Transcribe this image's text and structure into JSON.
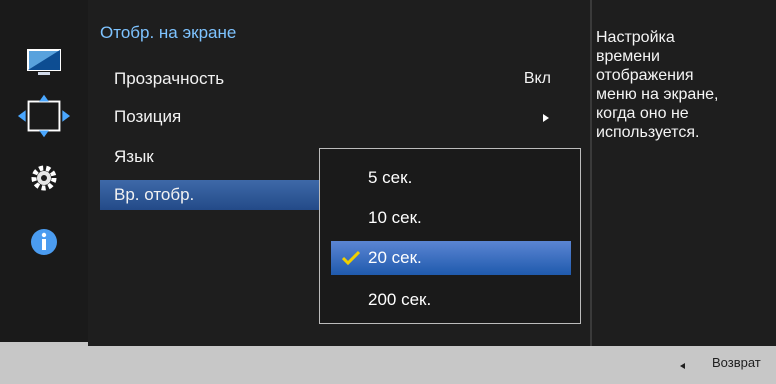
{
  "rail": {
    "icons": [
      "monitor-icon",
      "position-arrows-icon",
      "settings-gear-icon",
      "info-icon"
    ],
    "selected": "position-arrows-icon"
  },
  "menu": {
    "title": "Отобр. на экране",
    "items": [
      {
        "label": "Прозрачность",
        "value": "Вкл"
      },
      {
        "label": "Позиция",
        "value": ""
      },
      {
        "label": "Язык",
        "value": ""
      },
      {
        "label": "Вр. отобр.",
        "value": ""
      }
    ]
  },
  "submenu": {
    "options": [
      "5 сек.",
      "10 сек.",
      "20 сек.",
      "200 сек."
    ],
    "selected": "20 сек."
  },
  "help": {
    "text": "Настройка\nвремени\nотображения\nменю на экране,\nкогда оно не\nиспользуется."
  },
  "footer": {
    "back_label": "Возврат"
  },
  "colors": {
    "accent": "#2f5fb1",
    "menu_bg": "#1e1e1e",
    "title": "#7ec3ff",
    "bottom_bar": "#c7c7c7"
  }
}
